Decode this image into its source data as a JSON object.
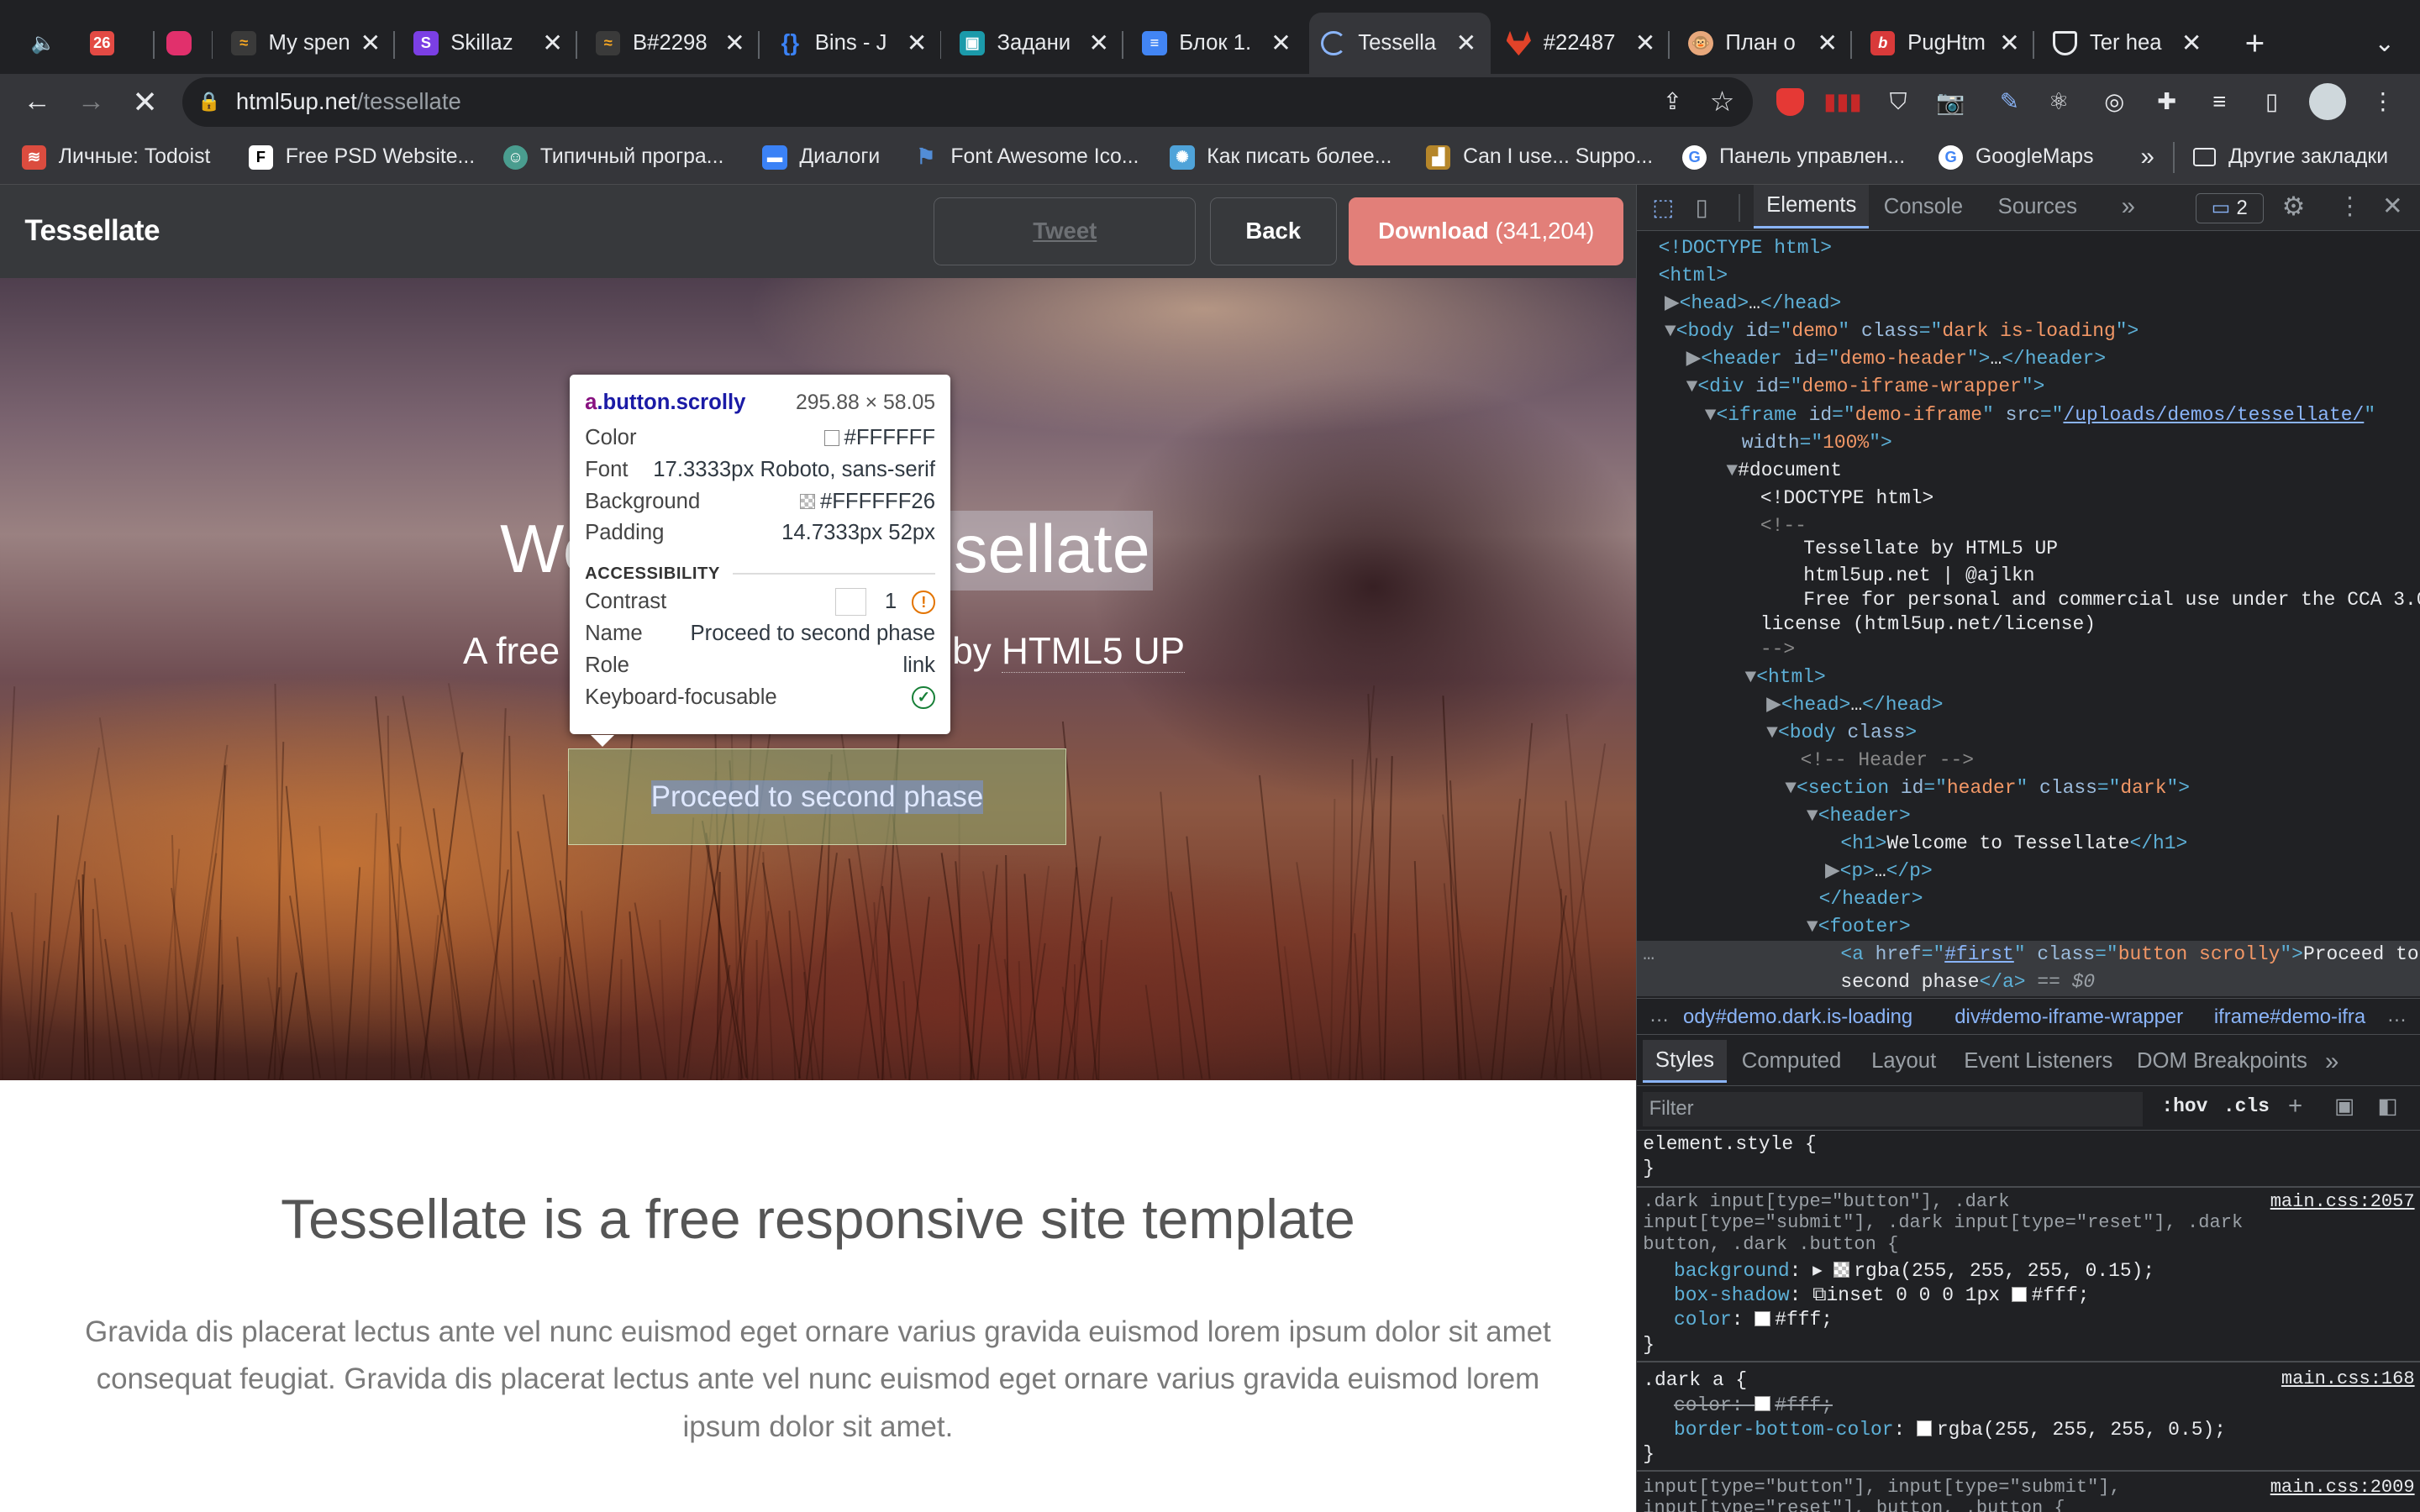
{
  "tabs": [
    {
      "title": "",
      "close": ""
    },
    {
      "title": "",
      "close": ""
    },
    {
      "title": "",
      "close": ""
    },
    {
      "title": "My spen",
      "close": "✕"
    },
    {
      "title": "Skillaz",
      "close": "✕"
    },
    {
      "title": "B#2298",
      "close": "✕"
    },
    {
      "title": "Bins - J",
      "close": "✕"
    },
    {
      "title": "Задани",
      "close": "✕"
    },
    {
      "title": "Блок 1.",
      "close": "✕"
    },
    {
      "title": "Tessella",
      "close": "✕"
    },
    {
      "title": "#22487",
      "close": "✕"
    },
    {
      "title": "План о",
      "close": "✕"
    },
    {
      "title": "PugHtm",
      "close": "✕"
    },
    {
      "title": "Ter hea",
      "close": "✕"
    }
  ],
  "tab_badge": "26",
  "new_tab": "+",
  "tab_menu": "⌄",
  "url": {
    "host": "html5up.net",
    "path": "/tessellate"
  },
  "bookmarks": [
    {
      "label": "Личные: Todoist",
      "color": "#db4c3f"
    },
    {
      "label": "Free PSD Website...",
      "color": "#ffffff"
    },
    {
      "label": "Типичный програ...",
      "color": "#4a9d8f"
    },
    {
      "label": "Диалоги",
      "color": "#3b82f6"
    },
    {
      "label": "Font Awesome Ico...",
      "color": "#528dd7"
    },
    {
      "label": "Как писать более...",
      "color": "#4fa3d9"
    },
    {
      "label": "Can I use... Suppo...",
      "color": "#b5862a"
    },
    {
      "label": "Панель управлен...",
      "color": "#ffffff"
    },
    {
      "label": "GoogleMaps",
      "color": "#ffffff"
    }
  ],
  "bookmarks_more": "»",
  "other_bookmarks": "Другие закладки",
  "page": {
    "brand": "Tessellate",
    "tweet": "Tweet",
    "back": "Back",
    "download": "Download",
    "download_count": "(341,204)",
    "hero_title_left": "We",
    "hero_title_right": "sellate",
    "hero_sub_left": "A free r",
    "hero_sub_right": "by ",
    "hero_sub_link": "HTML5 UP",
    "cta": "Proceed to second phase",
    "section_title": "Tessellate is a free responsive site template",
    "section_text": "Gravida dis placerat lectus ante vel nunc euismod eget ornare varius gravida euismod lorem ipsum dolor sit amet consequat feugiat. Gravida dis placerat lectus ante vel nunc euismod eget ornare varius gravida euismod lorem ipsum dolor sit amet."
  },
  "tooltip": {
    "tag": "a",
    "cls": ".button.scrolly",
    "size": "295.88 × 58.05",
    "rows": [
      {
        "k": "Color",
        "v": "#FFFFFF"
      },
      {
        "k": "Font",
        "v": "17.3333px Roboto, sans-serif"
      },
      {
        "k": "Background",
        "v": "#FFFFFF26"
      },
      {
        "k": "Padding",
        "v": "14.7333px 52px"
      }
    ],
    "accessibility": "ACCESSIBILITY",
    "contrast_label": "Contrast",
    "contrast_value": "1",
    "name_label": "Name",
    "name_value": "Proceed to second phase",
    "role_label": "Role",
    "role_value": "link",
    "kbd_label": "Keyboard-focusable"
  },
  "devtools": {
    "tabs": [
      "Elements",
      "Console",
      "Sources"
    ],
    "more": "»",
    "issues": "2",
    "crumbs": [
      "ody#demo.dark.is-loading",
      "div#demo-iframe-wrapper",
      "iframe#demo-ifra"
    ],
    "panel_tabs": [
      "Styles",
      "Computed",
      "Layout",
      "Event Listeners",
      "DOM Breakpoints"
    ],
    "filter": "Filter",
    "hov": ":hov",
    "cls": ".cls",
    "el_style": "element.style {",
    "brace": "}",
    "rule1_sel": ".dark input[type=\"button\"], .dark\ninput[type=\"submit\"], .dark input[type=\"reset\"], .dark\nbutton, .dark .button {",
    "rule1_src": "main.css:2057",
    "rule1_p1": "background",
    "rule1_v1": "rgba(255, 255, 255, 0.15);",
    "rule1_p2": "box-shadow",
    "rule1_v2": "inset 0 0 0 1px",
    "rule1_v2b": "#fff;",
    "rule1_p3": "color",
    "rule1_v3": "#fff;",
    "rule2_sel": ".dark a {",
    "rule2_src": "main.css:168",
    "rule2_p1": "color",
    "rule2_v1": "#fff;",
    "rule2_p2": "border-bottom-color",
    "rule2_v2": "rgba(255, 255, 255, 0.5);",
    "rule3_sel": "input[type=\"button\"], input[type=\"submit\"],\ninput[type=\"reset\"], button, .button {",
    "rule3_src": "main.css:2009"
  }
}
